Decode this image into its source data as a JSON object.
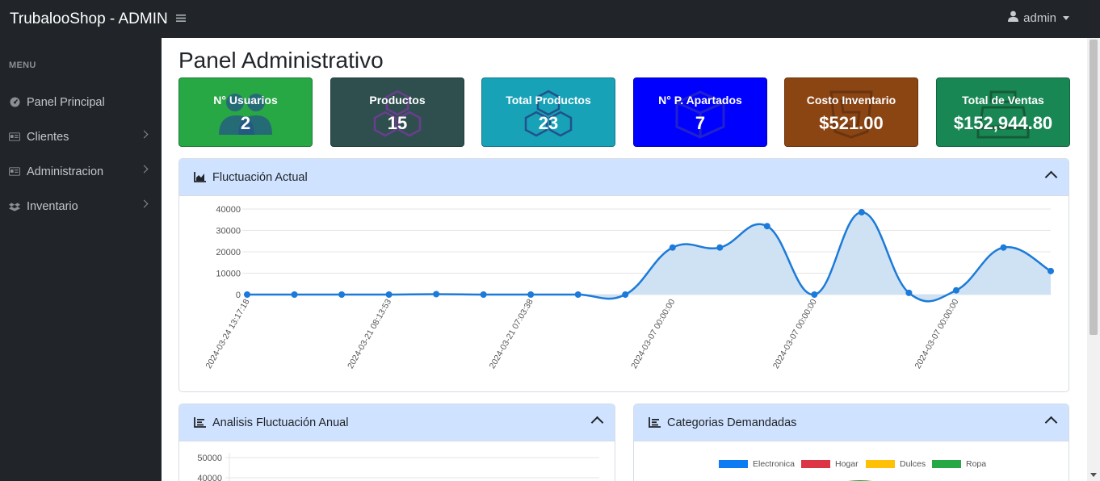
{
  "app": {
    "brand": "TrubalooShop - ADMIN",
    "user": "admin"
  },
  "sidebar": {
    "heading": "MENU",
    "items": [
      {
        "label": "Panel Principal",
        "icon": "dashboard-icon",
        "has_submenu": false
      },
      {
        "label": "Clientes",
        "icon": "id-card-icon",
        "has_submenu": true
      },
      {
        "label": "Administracion",
        "icon": "id-card-icon",
        "has_submenu": true
      },
      {
        "label": "Inventario",
        "icon": "dropbox-icon",
        "has_submenu": true
      }
    ]
  },
  "page": {
    "title": "Panel Administrativo"
  },
  "cards": [
    {
      "label": "N° Usuarios",
      "value": "2",
      "color": "#28a745",
      "icon": "users-icon"
    },
    {
      "label": "Productos",
      "value": "15",
      "color": "#2f4f4f",
      "icon": "cubes-icon"
    },
    {
      "label": "Total Productos",
      "value": "23",
      "color": "#17a2b8",
      "icon": "cubes-icon"
    },
    {
      "label": "N° P. Apartados",
      "value": "7",
      "color": "#0000ff",
      "icon": "box-icon"
    },
    {
      "label": "Costo Inventario",
      "value": "$521.00",
      "color": "#8b4513",
      "icon": "html5-icon"
    },
    {
      "label": "Total de Ventas",
      "value": "$152,944.80",
      "color": "#198754",
      "icon": "cash-register-icon"
    }
  ],
  "panels": {
    "fluctuacion": {
      "title": "Fluctuación Actual"
    },
    "anual": {
      "title": "Analisis Fluctuación Anual"
    },
    "categorias": {
      "title": "Categorias Demandadas"
    }
  },
  "chart_data": [
    {
      "type": "area",
      "title": "",
      "y_ticks": [
        0,
        10000,
        20000,
        30000,
        40000
      ],
      "ylim": [
        0,
        40000
      ],
      "x_tick_labels": [
        "2024-03-24 13:17:18",
        "2024-03-21 08:13:53",
        "2024-03-21 07:03:38",
        "2024-03-07 00:00:00",
        "2024-03-07 00:00:00",
        "2024-03-07 00:00:00"
      ],
      "values": [
        0,
        0,
        0,
        0,
        200,
        0,
        0,
        0,
        0,
        22000,
        22000,
        32000,
        0,
        38500,
        800,
        2000,
        22000,
        11000
      ],
      "line_color": "#1c7ad9",
      "fill_color": "#cfe2f3",
      "grid": true
    },
    {
      "type": "line",
      "title": "",
      "y_ticks": [
        40000,
        50000
      ]
    },
    {
      "type": "pie",
      "title": "",
      "legend": [
        {
          "name": "Electronica",
          "color": "#0d7bf2"
        },
        {
          "name": "Hogar",
          "color": "#dc3545"
        },
        {
          "name": "Dulces",
          "color": "#ffc107"
        },
        {
          "name": "Ropa",
          "color": "#28a745"
        }
      ],
      "legend_position": "top"
    }
  ]
}
